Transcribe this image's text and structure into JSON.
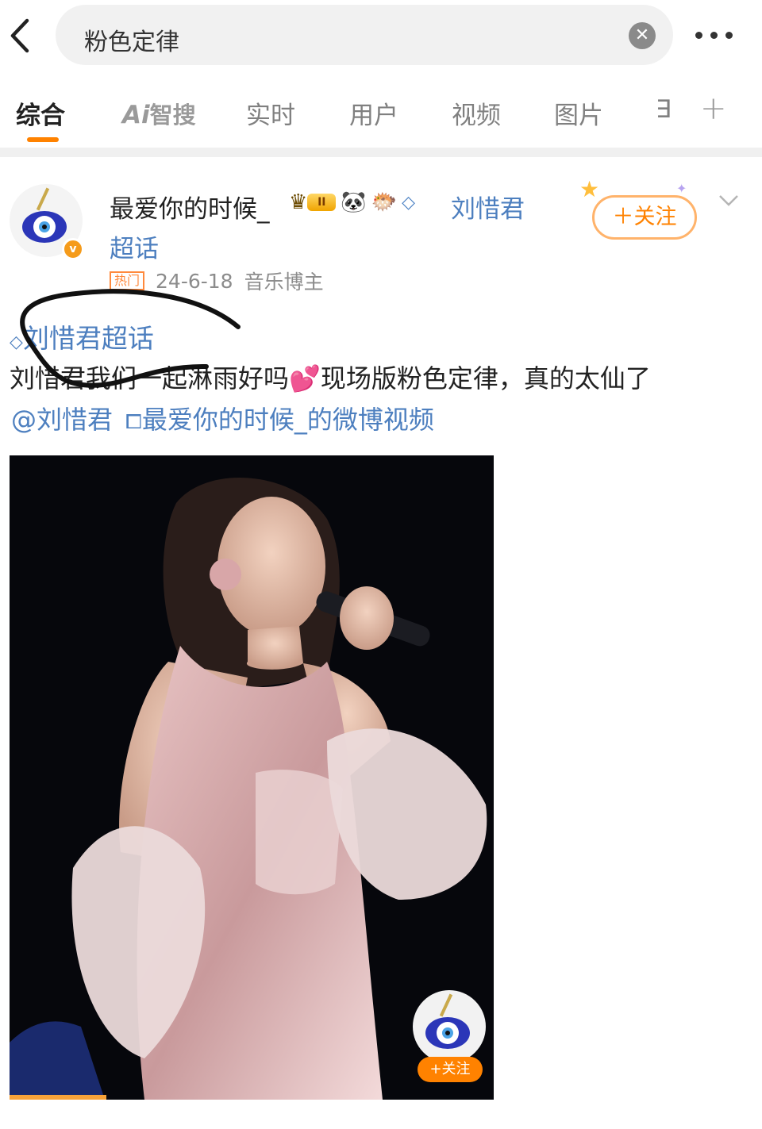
{
  "search": {
    "query": "粉色定律",
    "clear_glyph": "✕"
  },
  "tabs": [
    {
      "label": "综合",
      "active": true
    },
    {
      "label": "智搜",
      "prefix": "Ai"
    },
    {
      "label": "实时"
    },
    {
      "label": "用户"
    },
    {
      "label": "视频"
    },
    {
      "label": "图片"
    },
    {
      "label": "∃"
    },
    {
      "label": "+"
    }
  ],
  "post": {
    "author": "最爱你的时候_",
    "level_badge": "II",
    "linked_name": "刘惜君",
    "linked_name_suffix": "超话",
    "hot_tag": "热门",
    "date": "24-6-18",
    "role": "音乐博主",
    "follow_label": "＋关注",
    "topic": "刘惜君超话",
    "text_part1": "刘惜君我们一起淋雨好吗",
    "text_emoji": "💕",
    "text_part2": "现场版粉色定律，真的太仙了",
    "mention_user": "@刘惜君",
    "video_link": "最爱你的时候_的微博视频"
  },
  "video": {
    "follow_label": "+关注",
    "progress_fraction": 0.2
  },
  "colors": {
    "accent": "#ff8200",
    "link": "#4d7fbf"
  }
}
